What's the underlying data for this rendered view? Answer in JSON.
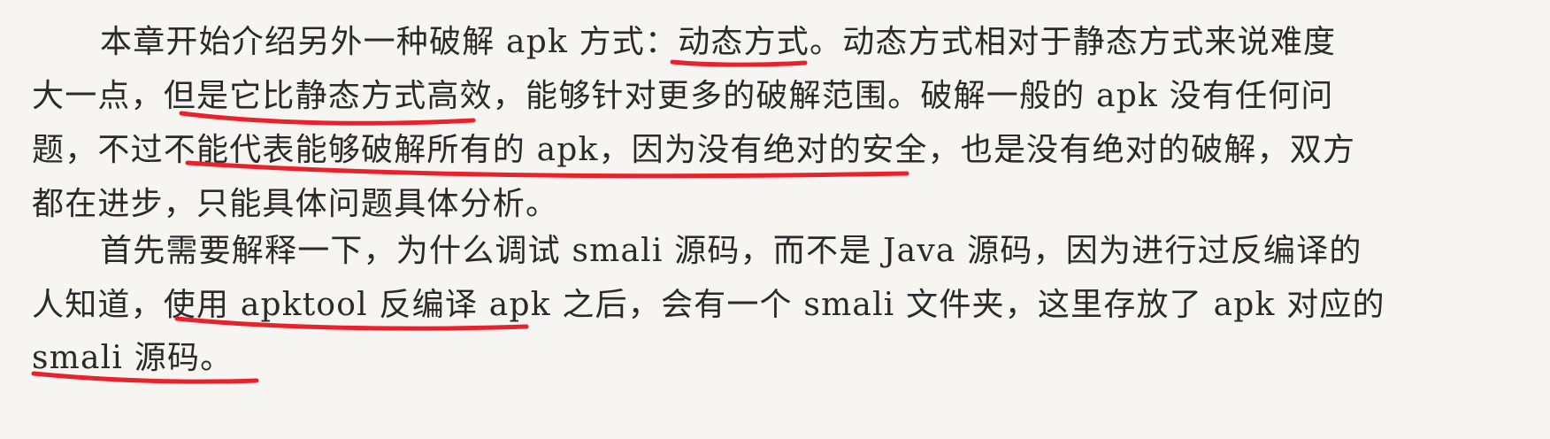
{
  "paragraphs": [
    {
      "lines": [
        "本章开始介绍另外一种破解 apk 方式：动态方式。动态方式相对于静态方式来说难度",
        "大一点，但是它比静态方式高效，能够针对更多的破解范围。破解一般的 apk 没有任何问",
        "题，不过不能代表能够破解所有的 apk，因为没有绝对的安全，也是没有绝对的破解，双方",
        "都在进步，只能具体问题具体分析。"
      ]
    },
    {
      "lines": [
        "首先需要解释一下，为什么调试 smali 源码，而不是 Java 源码，因为进行过反编译的",
        "人知道，使用 apktool 反编译 apk 之后，会有一个 smali 文件夹，这里存放了 apk 对应的",
        "smali 源码。"
      ]
    }
  ],
  "annotation_color": "#e8212b"
}
